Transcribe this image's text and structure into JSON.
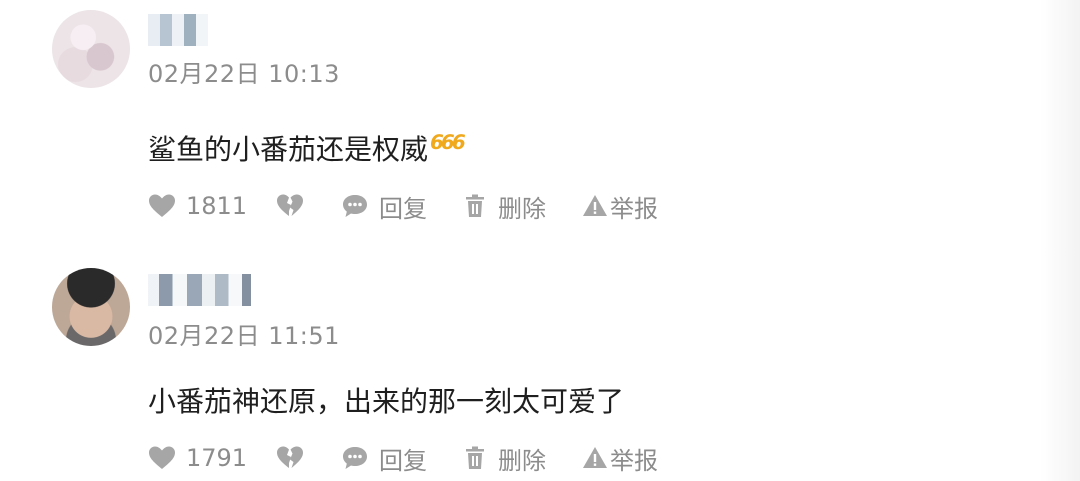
{
  "comments": [
    {
      "time": "02月22日 10:13",
      "text": "鲨鱼的小番茄还是权威",
      "emoji": "666",
      "likes": "1811",
      "reply_label": "回复",
      "delete_label": "删除",
      "report_label": "举报"
    },
    {
      "time": "02月22日 11:51",
      "text": "小番茄神还原，出来的那一刻太可爱了",
      "likes": "1791",
      "reply_label": "回复",
      "delete_label": "删除",
      "report_label": "举报"
    }
  ],
  "icons": {
    "like": "heart-icon",
    "dislike": "broken-heart-icon",
    "reply": "speech-bubble-icon",
    "delete": "trash-icon",
    "report": "warning-triangle-icon"
  },
  "colors": {
    "meta_gray": "#8c8c8c",
    "text": "#1f1f1f",
    "emoji": "#f0a81c"
  }
}
